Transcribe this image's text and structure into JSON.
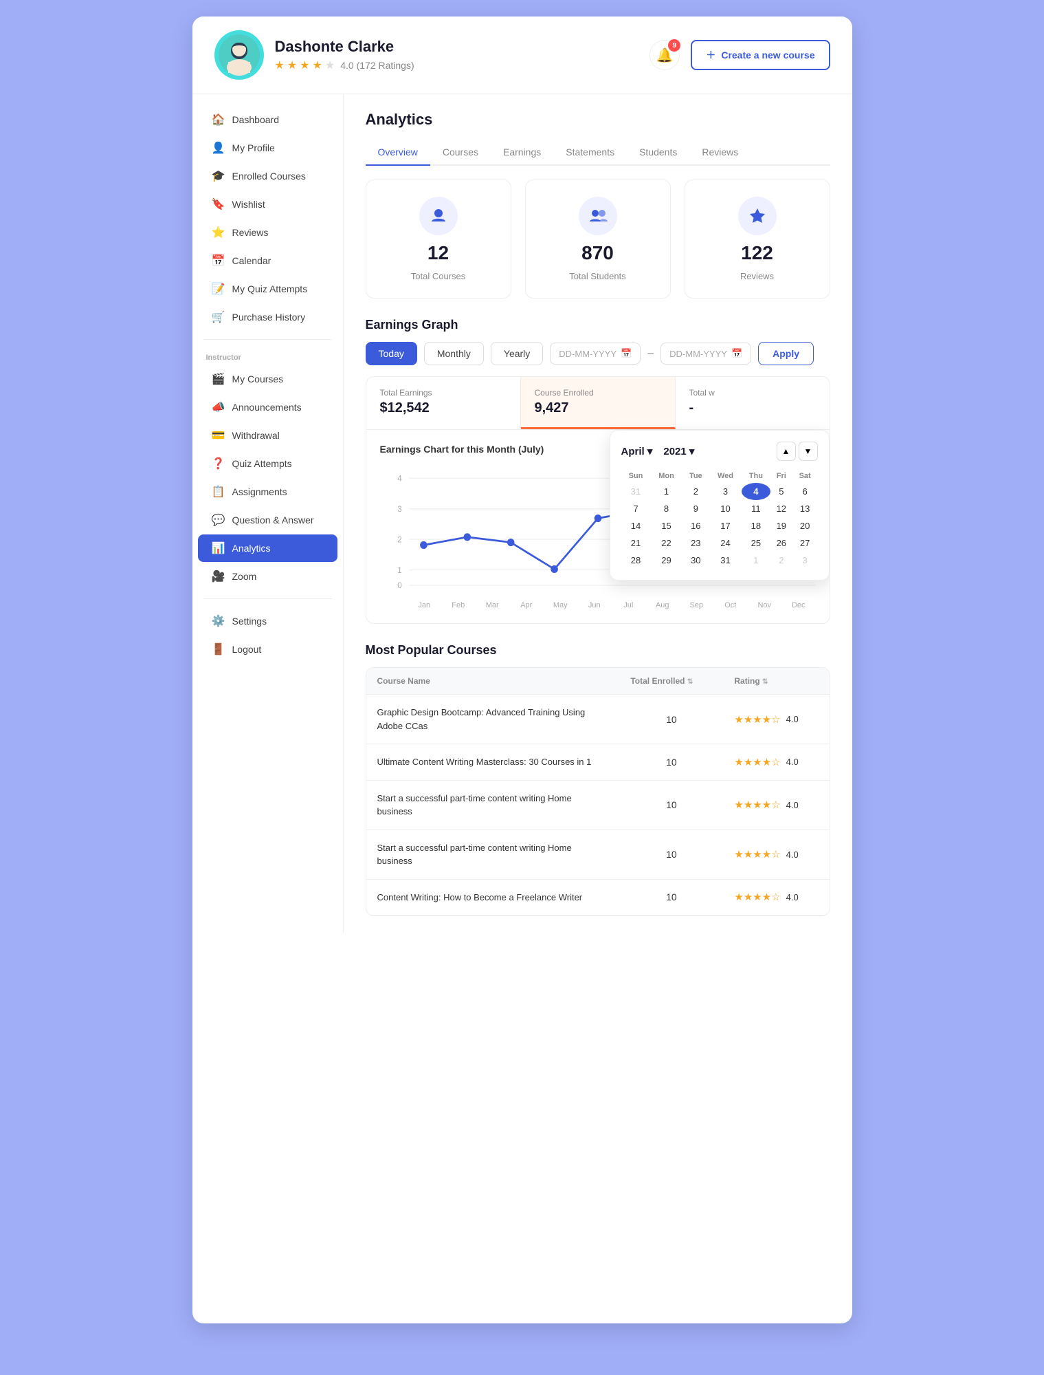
{
  "header": {
    "user_name": "Dashonte Clarke",
    "user_rating": "4.0",
    "user_ratings_count": "(172 Ratings)",
    "notification_count": "9",
    "create_btn_label": "Create a new course"
  },
  "sidebar": {
    "main_items": [
      {
        "id": "dashboard",
        "label": "Dashboard",
        "icon": "🏠"
      },
      {
        "id": "my-profile",
        "label": "My Profile",
        "icon": "👤"
      },
      {
        "id": "enrolled-courses",
        "label": "Enrolled Courses",
        "icon": "🎓"
      },
      {
        "id": "wishlist",
        "label": "Wishlist",
        "icon": "🔖"
      },
      {
        "id": "reviews",
        "label": "Reviews",
        "icon": "⭐"
      },
      {
        "id": "calendar",
        "label": "Calendar",
        "icon": "📅"
      },
      {
        "id": "my-quiz-attempts",
        "label": "My Quiz Attempts",
        "icon": "📝"
      },
      {
        "id": "purchase-history",
        "label": "Purchase History",
        "icon": "🛒"
      }
    ],
    "instructor_label": "Instructor",
    "instructor_items": [
      {
        "id": "my-courses",
        "label": "My Courses",
        "icon": "🎬"
      },
      {
        "id": "announcements",
        "label": "Announcements",
        "icon": "📣"
      },
      {
        "id": "withdrawal",
        "label": "Withdrawal",
        "icon": "💳"
      },
      {
        "id": "quiz-attempts",
        "label": "Quiz Attempts",
        "icon": "❓"
      },
      {
        "id": "assignments",
        "label": "Assignments",
        "icon": "📋"
      },
      {
        "id": "question-answer",
        "label": "Question & Answer",
        "icon": "💬"
      },
      {
        "id": "analytics",
        "label": "Analytics",
        "icon": "📊",
        "active": true
      },
      {
        "id": "zoom",
        "label": "Zoom",
        "icon": "🎥"
      }
    ],
    "bottom_items": [
      {
        "id": "settings",
        "label": "Settings",
        "icon": "⚙️"
      },
      {
        "id": "logout",
        "label": "Logout",
        "icon": "🚪"
      }
    ]
  },
  "analytics": {
    "page_title": "Analytics",
    "tabs": [
      "Overview",
      "Courses",
      "Earnings",
      "Statements",
      "Students",
      "Reviews"
    ],
    "active_tab": "Overview",
    "stats": [
      {
        "icon": "🎓",
        "value": "12",
        "label": "Total Courses"
      },
      {
        "icon": "👥",
        "value": "870",
        "label": "Total Students"
      },
      {
        "icon": "⭐",
        "value": "122",
        "label": "Reviews"
      }
    ]
  },
  "earnings_graph": {
    "title": "Earnings Graph",
    "period_buttons": [
      "Today",
      "Monthly",
      "Yearly"
    ],
    "active_period": "Today",
    "date_placeholder": "DD-MM-YYYY",
    "apply_label": "Apply",
    "summary": [
      {
        "label": "Total Earnings",
        "value": "$12,542"
      },
      {
        "label": "Course Enrolled",
        "value": "9,427"
      },
      {
        "label": "Total w",
        "value": "-"
      }
    ],
    "chart_title": "Earnings Chart for this Month (July)",
    "chart_months": [
      "Jan",
      "Feb",
      "Mar",
      "Apr",
      "May",
      "Jun",
      "Jul",
      "Aug",
      "Sep",
      "Oct",
      "Nov",
      "Dec"
    ],
    "chart_y_labels": [
      "0",
      "1",
      "2",
      "3",
      "4"
    ],
    "chart_points": [
      {
        "month": "Jan",
        "value": 1.5
      },
      {
        "month": "Feb",
        "value": 1.8
      },
      {
        "month": "Mar",
        "value": 1.6
      },
      {
        "month": "Apr",
        "value": 0.6
      },
      {
        "month": "May",
        "value": 2.5
      },
      {
        "month": "Jun",
        "value": 2.8
      },
      {
        "month": "Jul",
        "value": 3.8
      }
    ]
  },
  "calendar": {
    "month": "April",
    "year": "2021",
    "today_day": 4,
    "days_of_week": [
      "Sun",
      "Mon",
      "Tue",
      "Wed",
      "Thu",
      "Fri",
      "Sat"
    ],
    "weeks": [
      [
        31,
        1,
        2,
        3,
        4,
        5,
        6
      ],
      [
        7,
        8,
        9,
        10,
        11,
        12,
        13
      ],
      [
        14,
        15,
        16,
        17,
        18,
        19,
        20
      ],
      [
        21,
        22,
        23,
        24,
        25,
        26,
        27
      ],
      [
        28,
        29,
        30,
        31,
        1,
        2,
        3
      ]
    ],
    "other_month_days": [
      31,
      1,
      2,
      3
    ]
  },
  "popular_courses": {
    "title": "Most Popular Courses",
    "columns": [
      "Course Name",
      "Total Enrolled",
      "Rating"
    ],
    "courses": [
      {
        "name": "Graphic Design Bootcamp: Advanced Training Using Adobe CCas",
        "enrolled": 10,
        "rating": 4.0
      },
      {
        "name": "Ultimate Content Writing Masterclass: 30 Courses in 1",
        "enrolled": 10,
        "rating": 4.0
      },
      {
        "name": "Start a successful part-time content writing Home business",
        "enrolled": 10,
        "rating": 4.0
      },
      {
        "name": "Start a successful part-time content writing Home business",
        "enrolled": 10,
        "rating": 4.0
      },
      {
        "name": "Content Writing: How to Become a Freelance Writer",
        "enrolled": 10,
        "rating": 4.0
      }
    ]
  },
  "colors": {
    "primary": "#3b5bdb",
    "accent": "#f5a623",
    "bg": "#fff",
    "sidebar_active": "#3b5bdb"
  }
}
